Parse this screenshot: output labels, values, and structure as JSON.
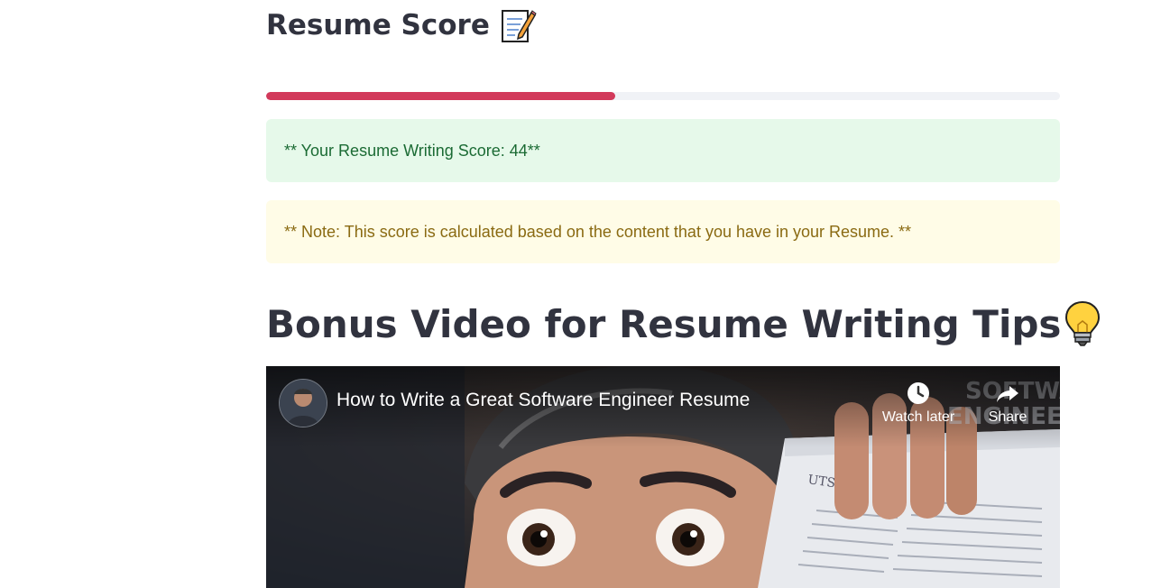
{
  "section_score": {
    "title": "Resume Score",
    "title_icon": "memo-icon"
  },
  "progress": {
    "value_percent": 44,
    "fill_color": "#d23a5b",
    "track_color": "#f0f2f6"
  },
  "alerts": {
    "success_text": "** Your Resume Writing Score: 44**",
    "warning_text": "** Note: This score is calculated based on the content that you have in your Resume. **"
  },
  "section_video": {
    "title": "Bonus Video for Resume Writing Tips",
    "title_icon": "light-bulb-icon"
  },
  "video": {
    "title": "How to Write a Great Software Engineer Resume",
    "watch_later_label": "Watch later",
    "share_label": "Share",
    "thumbnail_overlay_text": "SOFTWA\nENGINEERI",
    "paper_header": "UTSA"
  }
}
